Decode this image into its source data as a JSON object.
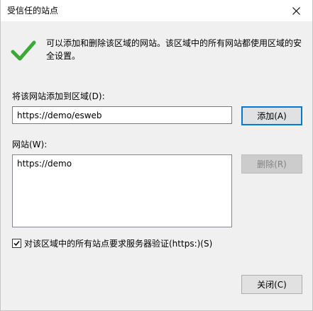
{
  "window": {
    "title": "受信任的站点"
  },
  "info": {
    "icon": "checkmark-icon",
    "icon_color": "#3aa935",
    "text": "可以添加和删除该区域的网站。该区域中的所有网站都使用区域的安全设置。"
  },
  "add_section": {
    "label": "将该网站添加到区域(D):",
    "input_value": "https://demo/esweb",
    "add_button": "添加(A)"
  },
  "sites_section": {
    "label": "网站(W):",
    "items": [
      "https://demo"
    ],
    "remove_button": "删除(R)"
  },
  "https_option": {
    "label": "对该区域中的所有站点要求服务器验证(https:)(S)",
    "checked": true
  },
  "footer": {
    "close_button": "关闭(C)"
  },
  "colors": {
    "accent": "#0078d7",
    "dialog_background": "#f0f0f0"
  }
}
